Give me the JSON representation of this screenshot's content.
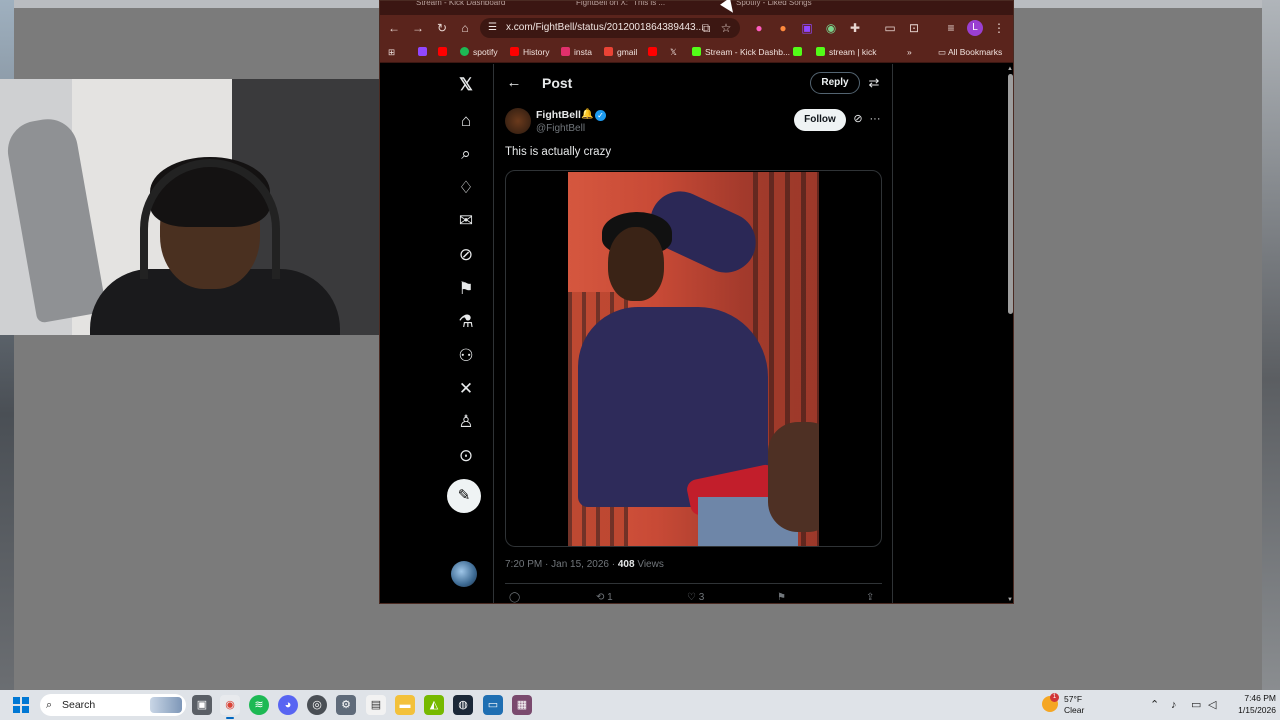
{
  "browser": {
    "tabs": [
      "Stream - Kick Dashboard",
      "FightBell on X: \"This is ...",
      "Spotify - Liked Songs"
    ],
    "address": "x.com/FightBell/status/2012001864389443...",
    "profile_initial": "L",
    "bookmarks": [
      {
        "label": "spotify",
        "color": "#1db954"
      },
      {
        "label": "History",
        "color": "#ff0000"
      },
      {
        "label": "insta",
        "color": "#e1306c"
      },
      {
        "label": "gmail",
        "color": "#ea4335"
      },
      {
        "label": "Stream - Kick Dashb...",
        "color": "#53fc18"
      },
      {
        "label": "stream | kick",
        "color": "#53fc18"
      }
    ],
    "bookmarks_overflow": "»",
    "all_bookmarks": "All Bookmarks"
  },
  "x": {
    "header_title": "Post",
    "reply_label": "Reply",
    "author_name": "FightBell",
    "author_handle": "@FightBell",
    "follow_label": "Follow",
    "post_text": "This is actually crazy",
    "time": "7:20 PM",
    "date": "Jan 15, 2026",
    "views_count": "408",
    "views_label": "Views",
    "reposts": "1",
    "likes": "3",
    "accent": "#1d9bf0"
  },
  "taskbar": {
    "search_placeholder": "Search",
    "weather_temp": "57°F",
    "weather_cond": "Clear",
    "weather_badge": "1",
    "time": "7:46 PM",
    "date": "1/15/2026"
  }
}
